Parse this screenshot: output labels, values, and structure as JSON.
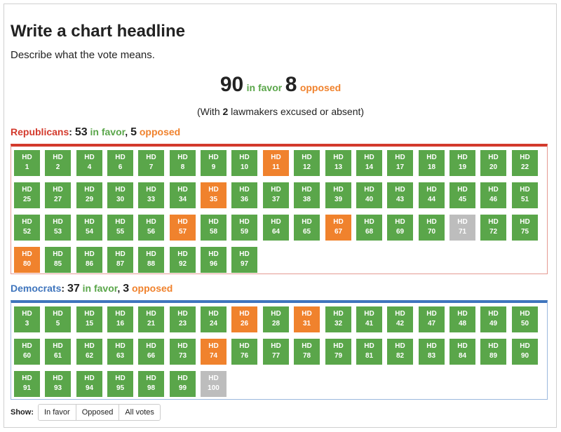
{
  "headline": "Write a chart headline",
  "description": "Describe what the vote means.",
  "totals": {
    "in_favor": "90",
    "in_favor_label": "in favor",
    "opposed": "8",
    "opposed_label": "opposed",
    "absent_prefix": "(With ",
    "absent_count": "2",
    "absent_suffix": " lawmakers excused or absent)"
  },
  "republicans": {
    "label": "Republicans",
    "in_favor": "53",
    "opposed": "5",
    "seats": [
      {
        "district": "1",
        "vote": "yes"
      },
      {
        "district": "2",
        "vote": "yes"
      },
      {
        "district": "4",
        "vote": "yes"
      },
      {
        "district": "6",
        "vote": "yes"
      },
      {
        "district": "7",
        "vote": "yes"
      },
      {
        "district": "8",
        "vote": "yes"
      },
      {
        "district": "9",
        "vote": "yes"
      },
      {
        "district": "10",
        "vote": "yes"
      },
      {
        "district": "11",
        "vote": "no"
      },
      {
        "district": "12",
        "vote": "yes"
      },
      {
        "district": "13",
        "vote": "yes"
      },
      {
        "district": "14",
        "vote": "yes"
      },
      {
        "district": "17",
        "vote": "yes"
      },
      {
        "district": "18",
        "vote": "yes"
      },
      {
        "district": "19",
        "vote": "yes"
      },
      {
        "district": "20",
        "vote": "yes"
      },
      {
        "district": "22",
        "vote": "yes"
      },
      {
        "district": "25",
        "vote": "yes"
      },
      {
        "district": "27",
        "vote": "yes"
      },
      {
        "district": "29",
        "vote": "yes"
      },
      {
        "district": "30",
        "vote": "yes"
      },
      {
        "district": "33",
        "vote": "yes"
      },
      {
        "district": "34",
        "vote": "yes"
      },
      {
        "district": "35",
        "vote": "no"
      },
      {
        "district": "36",
        "vote": "yes"
      },
      {
        "district": "37",
        "vote": "yes"
      },
      {
        "district": "38",
        "vote": "yes"
      },
      {
        "district": "39",
        "vote": "yes"
      },
      {
        "district": "40",
        "vote": "yes"
      },
      {
        "district": "43",
        "vote": "yes"
      },
      {
        "district": "44",
        "vote": "yes"
      },
      {
        "district": "45",
        "vote": "yes"
      },
      {
        "district": "46",
        "vote": "yes"
      },
      {
        "district": "51",
        "vote": "yes"
      },
      {
        "district": "52",
        "vote": "yes"
      },
      {
        "district": "53",
        "vote": "yes"
      },
      {
        "district": "54",
        "vote": "yes"
      },
      {
        "district": "55",
        "vote": "yes"
      },
      {
        "district": "56",
        "vote": "yes"
      },
      {
        "district": "57",
        "vote": "no"
      },
      {
        "district": "58",
        "vote": "yes"
      },
      {
        "district": "59",
        "vote": "yes"
      },
      {
        "district": "64",
        "vote": "yes"
      },
      {
        "district": "65",
        "vote": "yes"
      },
      {
        "district": "67",
        "vote": "no"
      },
      {
        "district": "68",
        "vote": "yes"
      },
      {
        "district": "69",
        "vote": "yes"
      },
      {
        "district": "70",
        "vote": "yes"
      },
      {
        "district": "71",
        "vote": "absent"
      },
      {
        "district": "72",
        "vote": "yes"
      },
      {
        "district": "75",
        "vote": "yes"
      },
      {
        "district": "80",
        "vote": "no"
      },
      {
        "district": "85",
        "vote": "yes"
      },
      {
        "district": "86",
        "vote": "yes"
      },
      {
        "district": "87",
        "vote": "yes"
      },
      {
        "district": "88",
        "vote": "yes"
      },
      {
        "district": "92",
        "vote": "yes"
      },
      {
        "district": "96",
        "vote": "yes"
      },
      {
        "district": "97",
        "vote": "yes"
      }
    ]
  },
  "democrats": {
    "label": "Democrats",
    "in_favor": "37",
    "opposed": "3",
    "seats": [
      {
        "district": "3",
        "vote": "yes"
      },
      {
        "district": "5",
        "vote": "yes"
      },
      {
        "district": "15",
        "vote": "yes"
      },
      {
        "district": "16",
        "vote": "yes"
      },
      {
        "district": "21",
        "vote": "yes"
      },
      {
        "district": "23",
        "vote": "yes"
      },
      {
        "district": "24",
        "vote": "yes"
      },
      {
        "district": "26",
        "vote": "no"
      },
      {
        "district": "28",
        "vote": "yes"
      },
      {
        "district": "31",
        "vote": "no"
      },
      {
        "district": "32",
        "vote": "yes"
      },
      {
        "district": "41",
        "vote": "yes"
      },
      {
        "district": "42",
        "vote": "yes"
      },
      {
        "district": "47",
        "vote": "yes"
      },
      {
        "district": "48",
        "vote": "yes"
      },
      {
        "district": "49",
        "vote": "yes"
      },
      {
        "district": "50",
        "vote": "yes"
      },
      {
        "district": "60",
        "vote": "yes"
      },
      {
        "district": "61",
        "vote": "yes"
      },
      {
        "district": "62",
        "vote": "yes"
      },
      {
        "district": "63",
        "vote": "yes"
      },
      {
        "district": "66",
        "vote": "yes"
      },
      {
        "district": "73",
        "vote": "yes"
      },
      {
        "district": "74",
        "vote": "no"
      },
      {
        "district": "76",
        "vote": "yes"
      },
      {
        "district": "77",
        "vote": "yes"
      },
      {
        "district": "78",
        "vote": "yes"
      },
      {
        "district": "79",
        "vote": "yes"
      },
      {
        "district": "81",
        "vote": "yes"
      },
      {
        "district": "82",
        "vote": "yes"
      },
      {
        "district": "83",
        "vote": "yes"
      },
      {
        "district": "84",
        "vote": "yes"
      },
      {
        "district": "89",
        "vote": "yes"
      },
      {
        "district": "90",
        "vote": "yes"
      },
      {
        "district": "91",
        "vote": "yes"
      },
      {
        "district": "93",
        "vote": "yes"
      },
      {
        "district": "94",
        "vote": "yes"
      },
      {
        "district": "95",
        "vote": "yes"
      },
      {
        "district": "98",
        "vote": "yes"
      },
      {
        "district": "99",
        "vote": "yes"
      },
      {
        "district": "100",
        "vote": "absent"
      }
    ]
  },
  "seat_prefix": "HD",
  "in_favor_word": "in favor",
  "opposed_word": "opposed",
  "filter": {
    "label": "Show:",
    "options": [
      "In favor",
      "Opposed",
      "All votes"
    ]
  },
  "colors": {
    "yes": "#5aa64a",
    "no": "#f0822d",
    "absent": "#bdbdbd",
    "republican": "#d33a2c",
    "democrat": "#3f75bd"
  }
}
